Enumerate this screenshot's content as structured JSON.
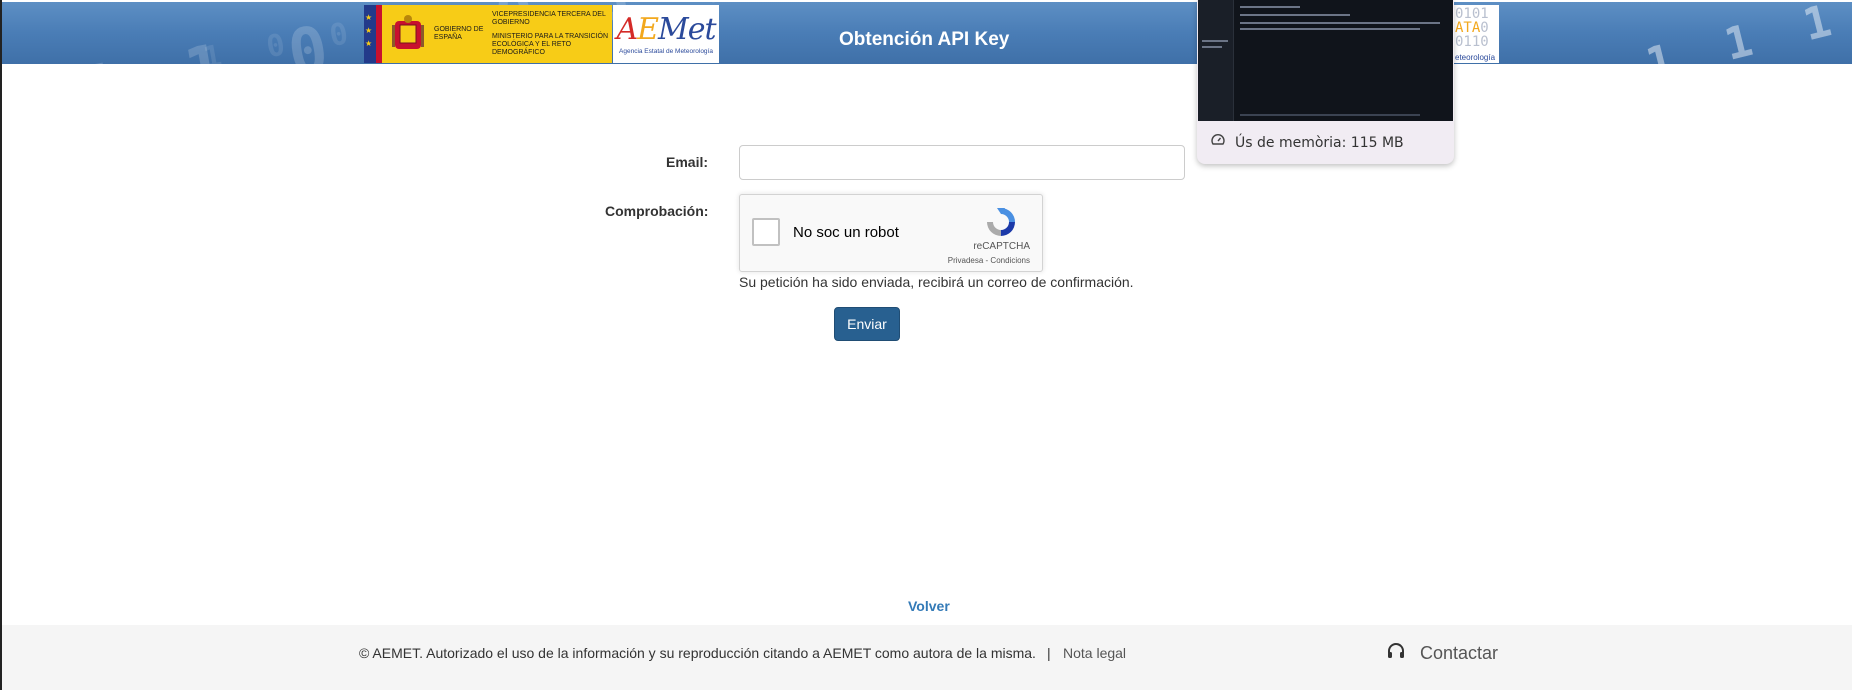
{
  "header": {
    "title": "Obtención API Key",
    "gob_text_a": "GOBIERNO DE ESPAÑA",
    "gob_text_b1": "VICEPRESIDENCIA TERCERA DEL GOBIERNO",
    "gob_text_b2": "MINISTERIO PARA LA TRANSICIÓN ECOLÓGICA Y EL RETO DEMOGRÁFICO",
    "aemet_sub": "Agencia Estatal de Meteorología",
    "data_logo_caption": "eteorología"
  },
  "memory_tooltip": {
    "text": "Ús de memòria: 115 MB",
    "icon": "gauge-icon"
  },
  "form": {
    "email_label": "Email:",
    "email_value": "",
    "check_label": "Comprobación:",
    "captcha_label": "No soc un robot",
    "captcha_brand": "reCAPTCHA",
    "captcha_links": "Privadesa - Condicions",
    "status_message": "Su petición ha sido enviada, recibirá un correo de confirmación.",
    "submit_label": "Enviar"
  },
  "footer": {
    "back_label": "Volver",
    "copyright": "© AEMET. Autorizado el uso de la información y su reproducción citando a AEMET como autora de la misma.",
    "separator": "|",
    "legal_label": "Nota legal",
    "contact_label": "Contactar",
    "contact_icon": "headset-icon"
  },
  "colors": {
    "header_blue": "#4a7db6",
    "button_blue": "#286090",
    "link_blue": "#337ab7",
    "footer_bg": "#f5f5f5",
    "gob_yellow": "#f7cc17"
  }
}
